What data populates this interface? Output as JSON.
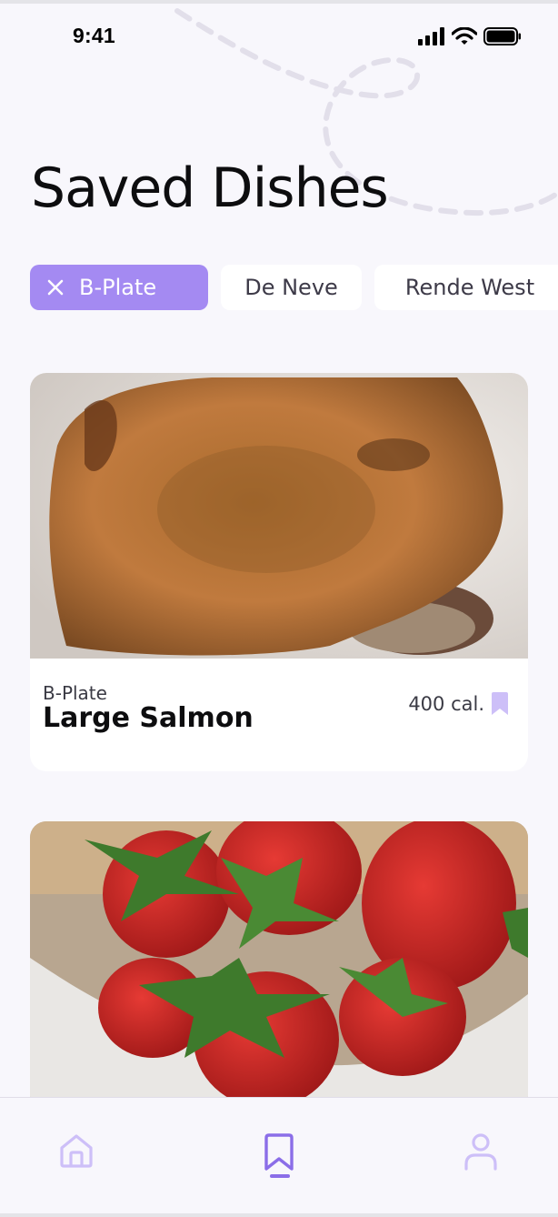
{
  "status_bar": {
    "time": "9:41"
  },
  "header": {
    "title": "Saved Dishes"
  },
  "filters": [
    {
      "label": "B-Plate",
      "active": true
    },
    {
      "label": "De Neve",
      "active": false
    },
    {
      "label": "Rende West",
      "active": false
    }
  ],
  "dishes": [
    {
      "hall": "B-Plate",
      "name": "Large Salmon",
      "calories": "400 cal.",
      "image": "salmon-photo",
      "saved": true
    },
    {
      "hall": "",
      "name": "",
      "calories": "",
      "image": "strawberries-photo",
      "saved": true
    }
  ],
  "tab_bar": {
    "items": [
      {
        "icon": "home-icon",
        "active": false
      },
      {
        "icon": "bookmark-icon",
        "active": true
      },
      {
        "icon": "profile-icon",
        "active": false
      }
    ]
  },
  "colors": {
    "accent": "#a48af2",
    "accent_dark": "#8b6ee8",
    "accent_light": "#cdbff8",
    "background": "#f8f7fc"
  }
}
